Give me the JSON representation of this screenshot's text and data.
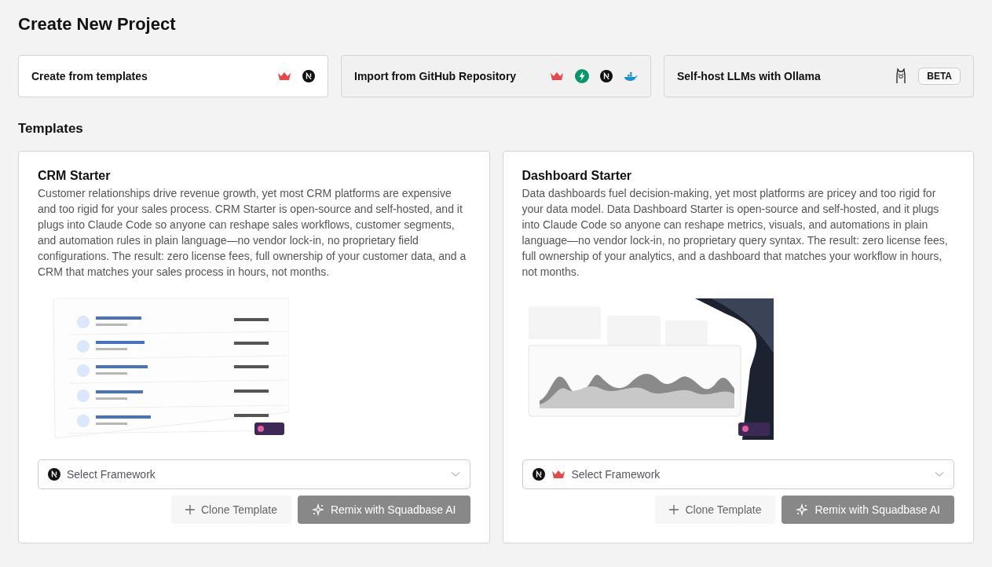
{
  "title": "Create New Project",
  "options": [
    {
      "label": "Create from templates",
      "selected": true
    },
    {
      "label": "Import from GitHub Repository",
      "selected": false
    },
    {
      "label": "Self-host LLMs with Ollama",
      "selected": false,
      "badge": "BETA"
    }
  ],
  "section_title": "Templates",
  "templates": [
    {
      "name": "CRM Starter",
      "description": "Customer relationships drive revenue growth, yet most CRM platforms are expensive and too rigid for your sales process. CRM Starter is open-source and self-hosted, and it plugs into Claude Code so anyone can reshape sales workflows, customer segments, and automation rules in plain language—no vendor lock-in, no proprietary field configurations. The result: zero license fees, full ownership of your customer data, and a CRM that matches your sales process in hours, not months.",
      "preview": {
        "kind": "picture"
      },
      "select_placeholder": "Select Framework",
      "buttons": [
        {
          "label": "Clone Template",
          "kind": "clone",
          "disabled": true
        },
        {
          "label": "Remix with Squadbase AI",
          "kind": "remix",
          "disabled": true
        }
      ]
    },
    {
      "name": "Dashboard Starter",
      "description": "Data dashboards fuel decision-making, yet most platforms are pricey and too rigid for your data model. Data Dashboard Starter is open-source and self-hosted, and it plugs into Claude Code so anyone can reshape metrics, visuals, and automations in plain language—no vendor lock-in, no proprietary query syntax. The result: zero license fees, full ownership of your analytics, and a dashboard that matches your workflow in hours, not months.",
      "preview": {
        "kind": "picture"
      },
      "select_placeholder": "Select Framework",
      "buttons": [
        {
          "label": "Clone Template",
          "kind": "clone",
          "disabled": true
        },
        {
          "label": "Remix with Squadbase AI",
          "kind": "remix",
          "disabled": true
        }
      ]
    }
  ]
}
